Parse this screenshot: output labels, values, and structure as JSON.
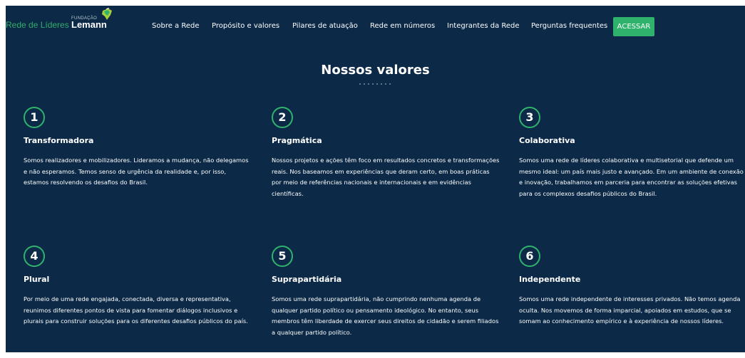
{
  "logo": {
    "rede": "Rede de Líderes",
    "fundacao": "FUNDAÇÃO",
    "lemann": "Lemann"
  },
  "nav": {
    "items": [
      "Sobre a Rede",
      "Propósito e valores",
      "Pilares de atuação",
      "Rede em números",
      "Integrantes da Rede",
      "Perguntas frequentes"
    ],
    "cta": "ACESSAR"
  },
  "section": {
    "title": "Nossos valores"
  },
  "values": [
    {
      "number": "1",
      "title": "Transformadora",
      "text": "Somos realizadores e mobilizadores. Lideramos a mudança, não delegamos e não esperamos. Temos senso de urgência da realidade e, por isso, estamos resolvendo os desafios do Brasil."
    },
    {
      "number": "2",
      "title": "Pragmática",
      "text": "Nossos projetos e ações têm foco em resultados concretos e transformações reais. Nos baseamos em experiências que deram certo, em boas práticas por meio de referências nacionais e internacionais e em evidências científicas."
    },
    {
      "number": "3",
      "title": "Colaborativa",
      "text": "Somos uma rede de líderes colaborativa e multisetorial que defende um mesmo ideal: um país mais justo e avançado. Em um ambiente de conexão e inovação, trabalhamos em parceria para encontrar as soluções efetivas para os complexos desafios públicos do Brasil."
    },
    {
      "number": "4",
      "title": "Plural",
      "text": "Por meio de uma rede engajada, conectada, diversa e representativa, reunimos diferentes pontos de vista para fomentar diálogos inclusivos e plurais para construir soluções para os diferentes desafios públicos do país."
    },
    {
      "number": "5",
      "title": "Suprapartidária",
      "text": "Somos uma rede suprapartidária, não cumprindo nenhuma agenda de qualquer partido político ou pensamento ideológico. No entanto, seus membros têm liberdade de exercer seus direitos de cidadão e serem filiados a qualquer partido político."
    },
    {
      "number": "6",
      "title": "Independente",
      "text": "Somos uma rede independente de interesses privados. Não temos agenda oculta. Nos movemos de forma imparcial, apoiados em estudos, que se somam ao conhecimento empírico e à experiência de nossos líderes."
    }
  ],
  "colors": {
    "background": "#0c2a47",
    "accent": "#2fb36c",
    "text": "#ffffff"
  },
  "icons": {
    "logo_mark": "brazil-map-leaf-icon"
  }
}
